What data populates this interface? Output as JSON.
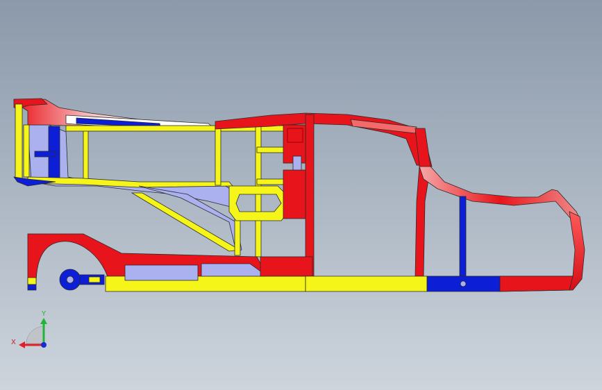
{
  "scene": {
    "name": "chassis-frame-side-view",
    "colors": {
      "frame_red": "#e8141b",
      "frame_yellow": "#f5f51a",
      "frame_blue": "#0c1fd6",
      "frame_light_blue": "#aab1ee",
      "frame_pink": "#f4a9a9",
      "frame_white": "#ffffff",
      "outline": "#2a2a2a"
    }
  },
  "triad": {
    "x_label": "X",
    "y_label": "Y",
    "x_color": "#e01f26",
    "y_color": "#1fb53a",
    "z_color": "#1a2ad8"
  }
}
